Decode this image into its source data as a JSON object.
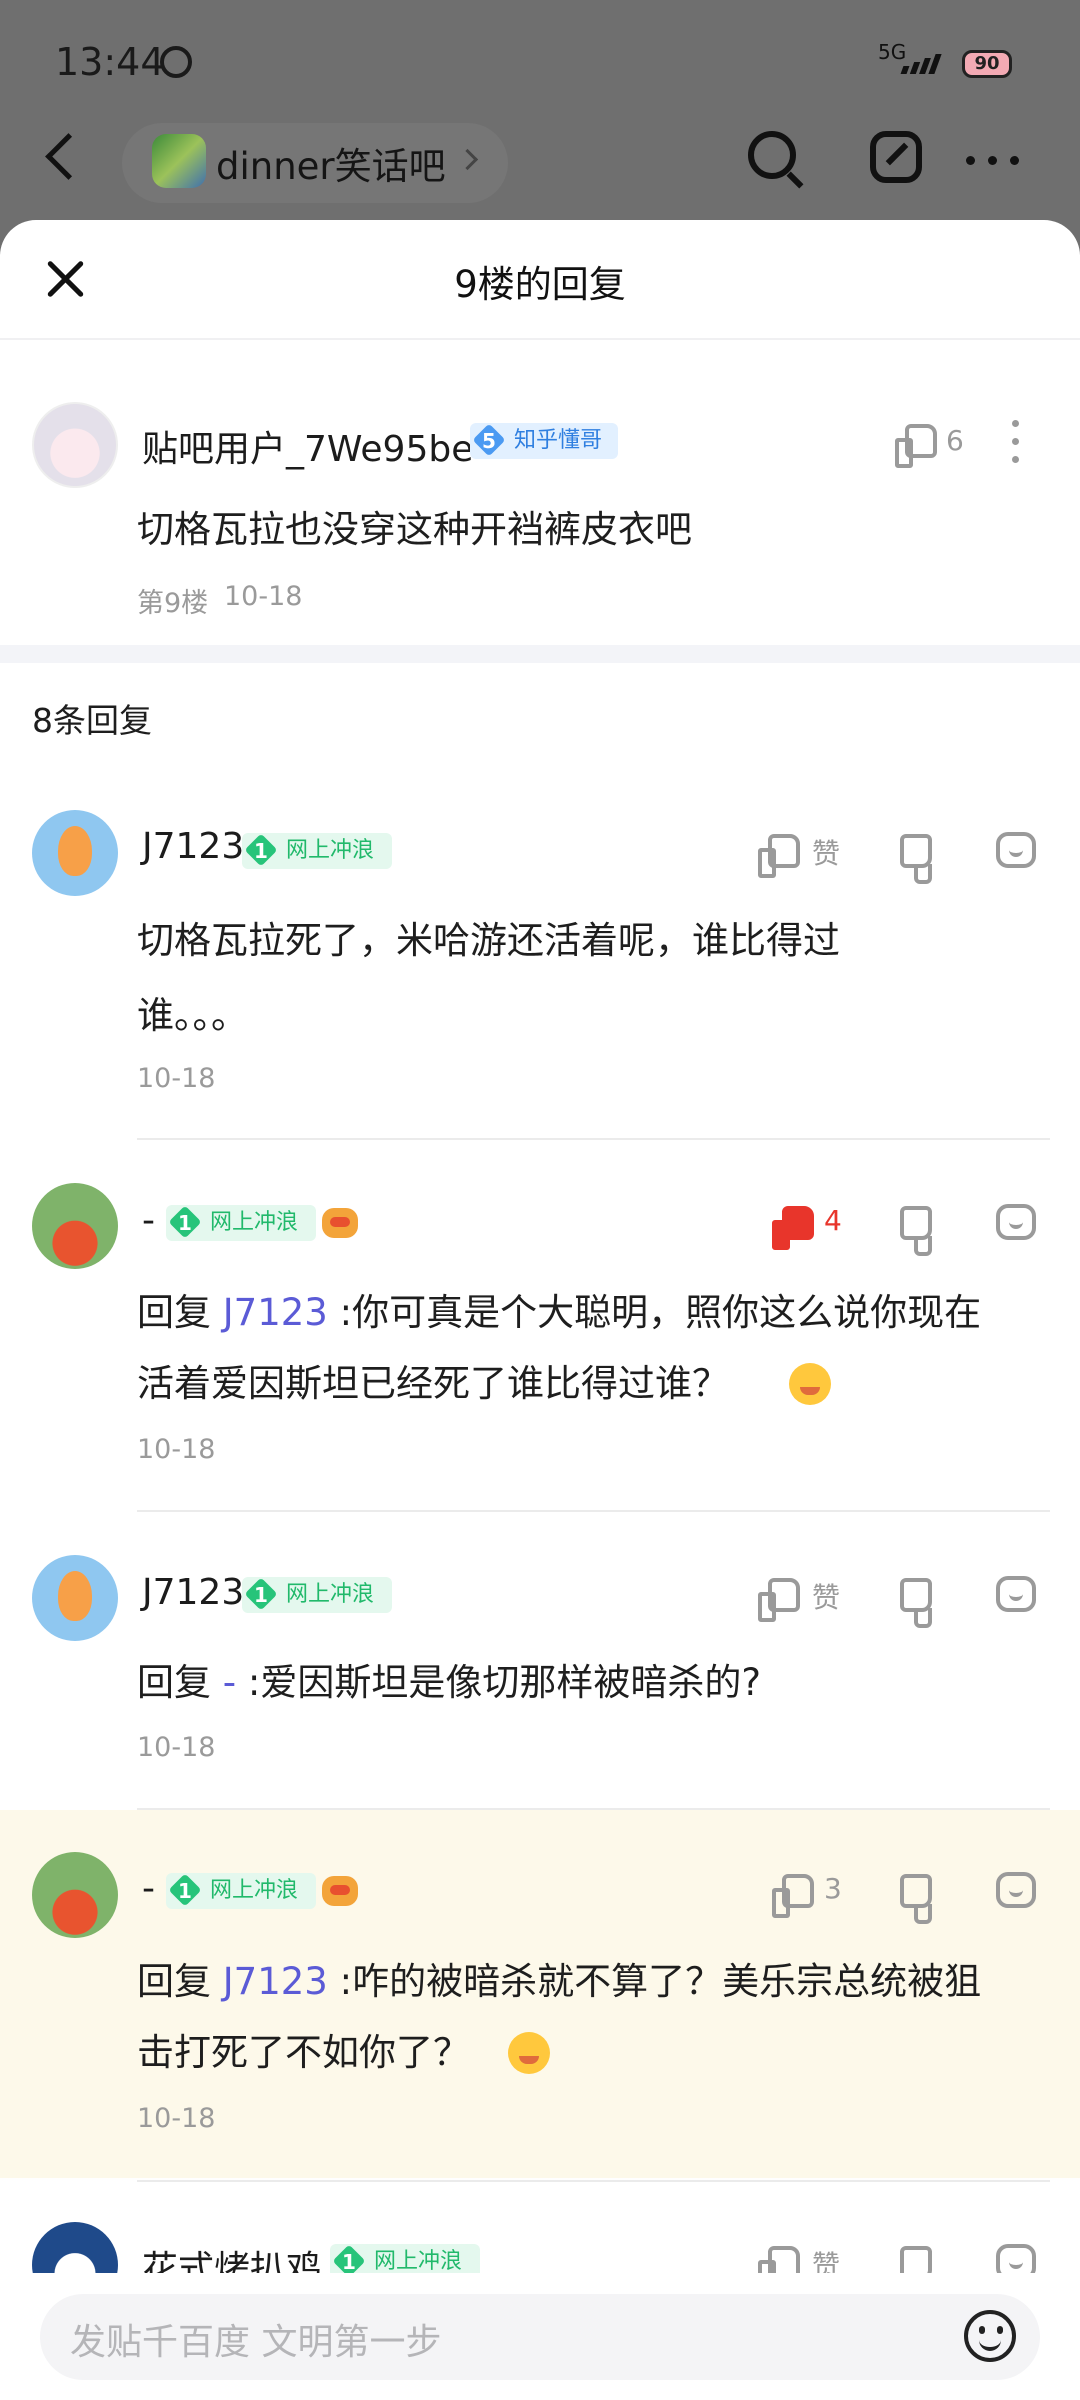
{
  "status": {
    "time": "13:44",
    "network": "5G",
    "battery": "90"
  },
  "topbar": {
    "forum_name": "dinner笑话吧"
  },
  "sheet": {
    "title": "9楼的回复"
  },
  "main_post": {
    "username": "贴吧用户_7We95be",
    "badge_level": "5",
    "badge_label": "知乎懂哥",
    "likes": "6",
    "text": "切格瓦拉也没穿这种开裆裤皮衣吧",
    "floor": "第9楼",
    "date": "10-18"
  },
  "replies_header": "8条回复",
  "replies": [
    {
      "username": "J7123",
      "badge_level": "1",
      "badge_label": "网上冲浪",
      "like_label": "赞",
      "lines": [
        "切格瓦拉死了，米哈游还活着呢，谁比得过",
        "谁。。。"
      ],
      "date": "10-18"
    },
    {
      "username": "-",
      "badge_level": "1",
      "badge_label": "网上冲浪",
      "like_label": "4",
      "prefix": "回复",
      "mention": "J7123",
      "lines": [
        ":你可真是个大聪明，照你这么说你现在",
        "活着爱因斯坦已经死了谁比得过谁？"
      ],
      "date": "10-18"
    },
    {
      "username": "J7123",
      "badge_level": "1",
      "badge_label": "网上冲浪",
      "like_label": "赞",
      "prefix": "回复",
      "mention": "-",
      "lines": [
        ":爱因斯坦是像切那样被暗杀的?"
      ],
      "date": "10-18"
    },
    {
      "username": "-",
      "badge_level": "1",
      "badge_label": "网上冲浪",
      "like_label": "3",
      "prefix": "回复",
      "mention": "J7123",
      "lines": [
        ":咋的被暗杀就不算了？美乐宗总统被狙",
        "击打死了不如你了？"
      ],
      "date": "10-18"
    },
    {
      "username": "花式烤扒鸡",
      "badge_level": "1",
      "badge_label": "网上冲浪",
      "like_label": "赞"
    }
  ],
  "input": {
    "placeholder": "发贴千百度 文明第一步"
  }
}
